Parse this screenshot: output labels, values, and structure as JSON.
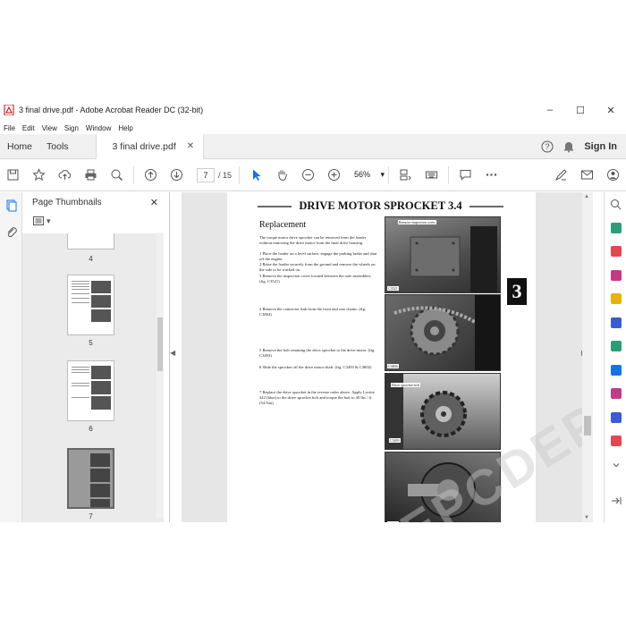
{
  "window": {
    "title": "3 final drive.pdf - Adobe Acrobat Reader DC (32-bit)",
    "controls": [
      "–",
      "☐",
      "✕"
    ]
  },
  "menu": [
    "File",
    "Edit",
    "View",
    "Sign",
    "Window",
    "Help"
  ],
  "tabs": {
    "home": "Home",
    "tools": "Tools",
    "document": "3 final drive.pdf",
    "sign_in": "Sign In"
  },
  "toolbar": {
    "current_page": "7",
    "page_total": "/ 15",
    "zoom": "56%"
  },
  "thumbnails": {
    "title": "Page Thumbnails",
    "pages": [
      "4",
      "5",
      "6",
      "7"
    ],
    "selected": "7"
  },
  "document": {
    "title": "DRIVE MOTOR SPROCKET 3.4",
    "section": "Replacement",
    "chapter": "3",
    "paragraphs": [
      "The torque motor drive sprocket can be removed from the loader without removing the drive motor from the final drive housing.",
      "1 Place the loader on a level surface, engage the parking brake and shut off the engine.",
      "2 Raise the loader securely from the ground and remove the wheels on the side to be worked on.",
      "3 Remove the inspection cover located between the axle assemblies. (fig. C3521)",
      "4 Remove the connector link from the front and rear chains. (fig. C3804)",
      "5 Remove the bolt retaining the drive sprocket to the drive motor. (fig. C3493)",
      "6 Slide the sprocket off the drive motor shaft. (fig. C3493 & C3802)",
      "7 Replace the drive sprocket in the reverse order above. Apply Loctite 242 (blue) to the drive sprocket bolt and torque the bolt to 40 lbs / ft (54 Nm)"
    ],
    "figures": [
      {
        "id": "C3521",
        "label": "Remove inspection cover"
      },
      {
        "id": "C3804",
        "label": ""
      },
      {
        "id": "C3493",
        "label": "Drive sprocket bolt"
      },
      {
        "id": "C3802",
        "label": ""
      }
    ]
  },
  "watermark": "WWW.EPCDEPOT.COM"
}
